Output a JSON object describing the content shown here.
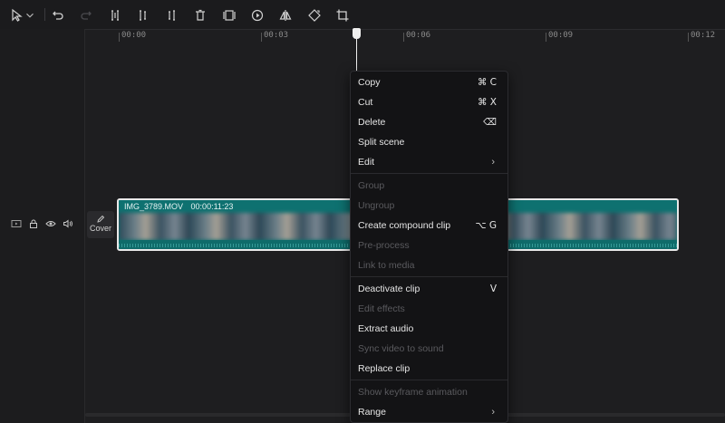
{
  "toolbar": {
    "items": [
      "select-tool",
      "dropdown",
      "undo",
      "redo",
      "split",
      "split-left",
      "split-right",
      "delete",
      "freeze-frame",
      "play-reverse",
      "mirror",
      "rotate",
      "crop"
    ]
  },
  "ruler": {
    "labels": [
      "00:00",
      "00:03",
      "00:06",
      "00:09",
      "00:12"
    ]
  },
  "track": {
    "cover_label": "Cover"
  },
  "clip": {
    "name": "IMG_3789.MOV",
    "duration": "00:00:11:23"
  },
  "context_menu": {
    "items": [
      {
        "label": "Copy",
        "shortcut": "⌘  C",
        "enabled": true
      },
      {
        "label": "Cut",
        "shortcut": "⌘  X",
        "enabled": true
      },
      {
        "label": "Delete",
        "shortcut": "⌫",
        "enabled": true
      },
      {
        "label": "Split scene",
        "shortcut": "",
        "enabled": true
      },
      {
        "label": "Edit",
        "shortcut": "",
        "submenu": true,
        "enabled": true
      },
      {
        "label": "Group",
        "shortcut": "",
        "enabled": false
      },
      {
        "label": "Ungroup",
        "shortcut": "",
        "enabled": false
      },
      {
        "label": "Create compound clip",
        "shortcut": "⌥  G",
        "enabled": true
      },
      {
        "label": "Pre-process",
        "shortcut": "",
        "enabled": false
      },
      {
        "label": "Link to media",
        "shortcut": "",
        "enabled": false
      },
      {
        "label": "Deactivate clip",
        "shortcut": "V",
        "enabled": true
      },
      {
        "label": "Edit effects",
        "shortcut": "",
        "enabled": false
      },
      {
        "label": "Extract audio",
        "shortcut": "",
        "enabled": true
      },
      {
        "label": "Sync video to sound",
        "shortcut": "",
        "enabled": false
      },
      {
        "label": "Replace clip",
        "shortcut": "",
        "enabled": true
      },
      {
        "label": "Show keyframe animation",
        "shortcut": "",
        "enabled": false
      },
      {
        "label": "Range",
        "shortcut": "",
        "submenu": true,
        "enabled": true
      }
    ]
  }
}
